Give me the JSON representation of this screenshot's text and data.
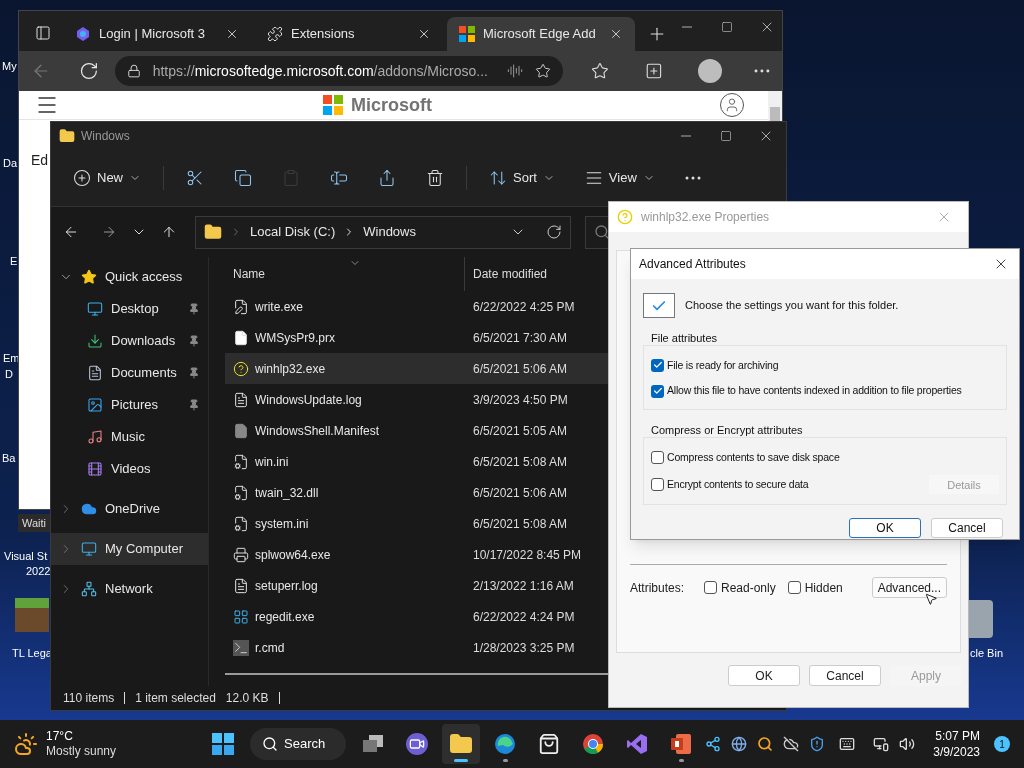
{
  "desktop_labels": [
    {
      "label": "My"
    },
    {
      "label": "Da"
    },
    {
      "label": "E"
    },
    {
      "label": "Em"
    },
    {
      "label": "D"
    },
    {
      "label": "Ba"
    },
    {
      "label": "Visual St"
    },
    {
      "label": "2022"
    },
    {
      "label": "TL Lega"
    },
    {
      "label": "cle Bin"
    }
  ],
  "browser": {
    "tabs": [
      {
        "kind": "copilot",
        "title": "Login | Microsoft 3",
        "selected": false
      },
      {
        "kind": "extensions",
        "title": "Extensions",
        "selected": false
      },
      {
        "kind": "microsoft",
        "title": "Microsoft Edge Add",
        "selected": true
      }
    ],
    "url": {
      "scheme": "https://",
      "host": "microsoftedge.microsoft.com",
      "path": "/addons/Microso..."
    },
    "brand": "Microsoft",
    "page_heading": "Ed",
    "tooltip": "Waiti"
  },
  "explorer": {
    "title": "Windows",
    "toolbar": [
      {
        "kind": "new",
        "label": "New",
        "disabled": false
      },
      {
        "kind": "cut",
        "disabled": false
      },
      {
        "kind": "copy",
        "disabled": false
      },
      {
        "kind": "paste",
        "disabled": true
      },
      {
        "kind": "rename",
        "disabled": false
      },
      {
        "kind": "share",
        "disabled": false
      },
      {
        "kind": "delete",
        "disabled": false
      },
      {
        "kind": "sort",
        "label": "Sort",
        "disabled": false
      },
      {
        "kind": "view",
        "label": "View",
        "disabled": false
      },
      {
        "kind": "more",
        "disabled": false
      }
    ],
    "path": [
      "Local Disk (C:)",
      "Windows"
    ],
    "nav": [
      {
        "kind": "star",
        "label": "Quick access",
        "expanded": true,
        "selected": false,
        "children": [
          {
            "kind": "desktop",
            "label": "Desktop",
            "pinned": true,
            "selected": false
          },
          {
            "kind": "download",
            "label": "Downloads",
            "pinned": true,
            "selected": false
          },
          {
            "kind": "document",
            "label": "Documents",
            "pinned": true,
            "selected": false
          },
          {
            "kind": "picture",
            "label": "Pictures",
            "pinned": true,
            "selected": false
          },
          {
            "kind": "music",
            "label": "Music",
            "pinned": false,
            "selected": false
          },
          {
            "kind": "video",
            "label": "Videos",
            "pinned": false,
            "selected": false
          }
        ]
      },
      {
        "kind": "cloud",
        "label": "OneDrive",
        "expanded": false,
        "selected": false
      },
      {
        "kind": "computer",
        "label": "My Computer",
        "expanded": false,
        "selected": true
      },
      {
        "kind": "network",
        "label": "Network",
        "expanded": false,
        "selected": false
      }
    ],
    "columns": [
      "Name",
      "Date modified"
    ],
    "files": [
      {
        "kind": "write",
        "name": "write.exe",
        "date": "6/22/2022 4:25 PM",
        "selected": false
      },
      {
        "kind": "blank",
        "name": "WMSysPr9.prx",
        "date": "6/5/2021 7:30 AM",
        "selected": false
      },
      {
        "kind": "help",
        "name": "winhlp32.exe",
        "date": "6/5/2021 5:06 AM",
        "selected": true
      },
      {
        "kind": "text",
        "name": "WindowsUpdate.log",
        "date": "3/9/2023 4:50 PM",
        "selected": false
      },
      {
        "kind": "grey",
        "name": "WindowsShell.Manifest",
        "date": "6/5/2021 5:05 AM",
        "selected": false
      },
      {
        "kind": "settings",
        "name": "win.ini",
        "date": "6/5/2021 5:08 AM",
        "selected": false
      },
      {
        "kind": "settings",
        "name": "twain_32.dll",
        "date": "6/5/2021 5:06 AM",
        "selected": false
      },
      {
        "kind": "settings",
        "name": "system.ini",
        "date": "6/5/2021 5:08 AM",
        "selected": false
      },
      {
        "kind": "printer",
        "name": "splwow64.exe",
        "date": "10/17/2022 8:45 PM",
        "selected": false
      },
      {
        "kind": "text",
        "name": "setuperr.log",
        "date": "2/13/2022 1:16 AM",
        "selected": false
      },
      {
        "kind": "registry",
        "name": "regedit.exe",
        "date": "6/22/2022 4:24 PM",
        "selected": false
      },
      {
        "kind": "cmd",
        "name": "r.cmd",
        "date": "1/28/2023 3:25 PM",
        "selected": false
      }
    ],
    "status": {
      "count": "110 items",
      "selection": "1 item selected",
      "size": "12.0 KB"
    }
  },
  "properties": {
    "title": "winhlp32.exe Properties",
    "attributes_label": "Attributes:",
    "attributes": [
      {
        "label": "Read-only",
        "checked": false
      },
      {
        "label": "Hidden",
        "checked": false
      }
    ],
    "advanced_button": "Advanced...",
    "buttons": [
      {
        "label": "OK",
        "disabled": false
      },
      {
        "label": "Cancel",
        "disabled": false
      },
      {
        "label": "Apply",
        "disabled": true
      }
    ]
  },
  "advanced": {
    "title": "Advanced Attributes",
    "intro": "Choose the settings you want for this folder.",
    "groups": [
      {
        "title": "File attributes",
        "options": [
          {
            "label": "File is ready for archiving",
            "checked": true
          },
          {
            "label": "Allow this file to have contents indexed in addition to file properties",
            "checked": true
          }
        ]
      },
      {
        "title": "Compress or Encrypt attributes",
        "options": [
          {
            "label": "Compress contents to save disk space",
            "checked": false
          },
          {
            "label": "Encrypt contents to secure data",
            "checked": false
          }
        ],
        "button": {
          "label": "Details",
          "disabled": true
        }
      }
    ],
    "buttons": [
      {
        "label": "OK",
        "default": true
      },
      {
        "label": "Cancel",
        "default": false
      }
    ]
  },
  "taskbar": {
    "weather": {
      "temp": "17°C",
      "condition": "Mostly sunny"
    },
    "search": "Search",
    "apps": [
      {
        "kind": "start",
        "running": false,
        "active": false
      },
      {
        "kind": "taskview",
        "running": false,
        "active": false
      },
      {
        "kind": "teams",
        "running": false,
        "active": false
      },
      {
        "kind": "explorer",
        "running": true,
        "active": true
      },
      {
        "kind": "edge",
        "running": true,
        "active": false
      },
      {
        "kind": "store",
        "running": false,
        "active": false
      },
      {
        "kind": "chrome",
        "running": false,
        "active": false
      },
      {
        "kind": "studio",
        "running": false,
        "active": false
      },
      {
        "kind": "powerpoint",
        "running": true,
        "active": false
      }
    ],
    "time": "5:07 PM",
    "date": "3/9/2023",
    "notifications": "1"
  }
}
